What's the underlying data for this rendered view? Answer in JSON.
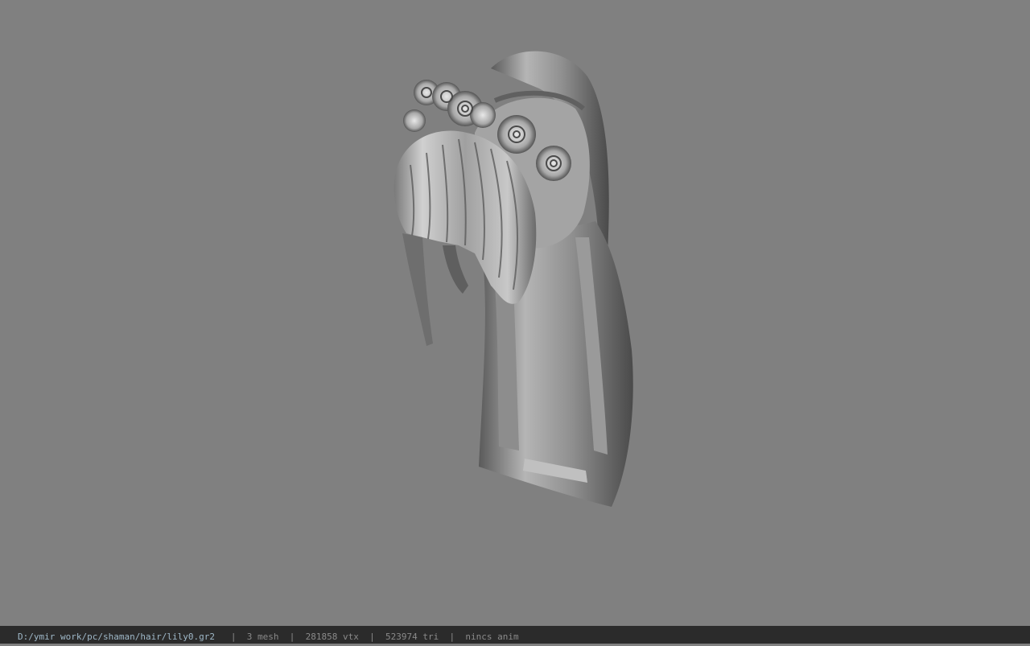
{
  "status_bar": {
    "file_path": "D:/ymir work/pc/shaman/hair/lily0.gr2",
    "separator": "|",
    "mesh_count": "3 mesh",
    "vertex_count": "281858 vtx",
    "triangle_count": "523974 tri",
    "anim_status": "nincs anim"
  },
  "viewport": {
    "background_color": "#808080",
    "model": "hair-model"
  }
}
